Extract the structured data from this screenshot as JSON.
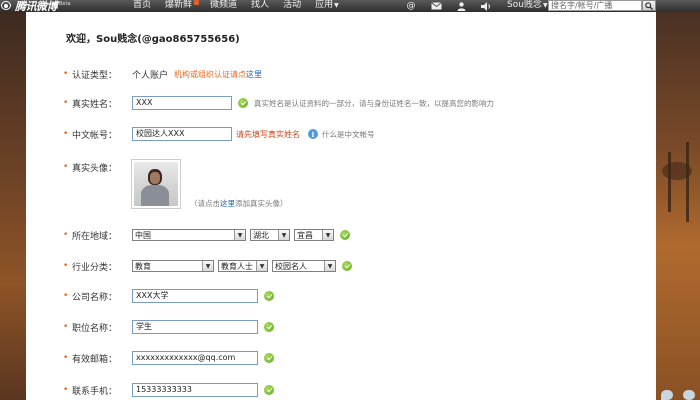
{
  "header": {
    "logo_text": "腾讯微博",
    "logo_badge": "Beta",
    "nav": [
      {
        "label": "首页"
      },
      {
        "label": "爆新鲜"
      },
      {
        "label": "微频道"
      },
      {
        "label": "找人"
      },
      {
        "label": "活动"
      },
      {
        "label": "应用"
      }
    ],
    "user_menu": "Sou贱念",
    "search_placeholder": "搜名字/帐号/广播",
    "icons": [
      "at-icon",
      "mail-icon",
      "user-icon",
      "speaker-icon"
    ]
  },
  "welcome": "欢迎，Sou贱念(@gao865755656)",
  "form": {
    "auth_type": {
      "label": "认证类型：",
      "value": "个人账户",
      "link_prefix": "机构或组织认证请点",
      "link_text": "这里"
    },
    "real_name": {
      "label": "真实姓名：",
      "value": "XXX",
      "hint": "真实姓名是认证资料的一部分，请与身份证姓名一致，以提高您的影响力"
    },
    "chinese_account": {
      "label": "中文帐号：",
      "value": "校园达人XXX",
      "warning": "请先填写真实姓名",
      "info_text": "什么是中文帐号"
    },
    "avatar": {
      "label": "真实头像：",
      "note_prefix": "（请点击",
      "note_link": "这里",
      "note_suffix": "添加真实头像）"
    },
    "region": {
      "label": "所在地域：",
      "country": "中国",
      "province": "湖北",
      "city": "宜昌"
    },
    "industry": {
      "label": "行业分类：",
      "level1": "教育",
      "level2": "教育人士",
      "level3": "校园名人"
    },
    "company": {
      "label": "公司名称：",
      "value": "XXX大学"
    },
    "position": {
      "label": "职位名称：",
      "value": "学生"
    },
    "email": {
      "label": "有效邮箱：",
      "value": "xxxxxxxxxxxxx@qq.com"
    },
    "phone": {
      "label": "联系手机：",
      "value": "15333333333"
    }
  }
}
